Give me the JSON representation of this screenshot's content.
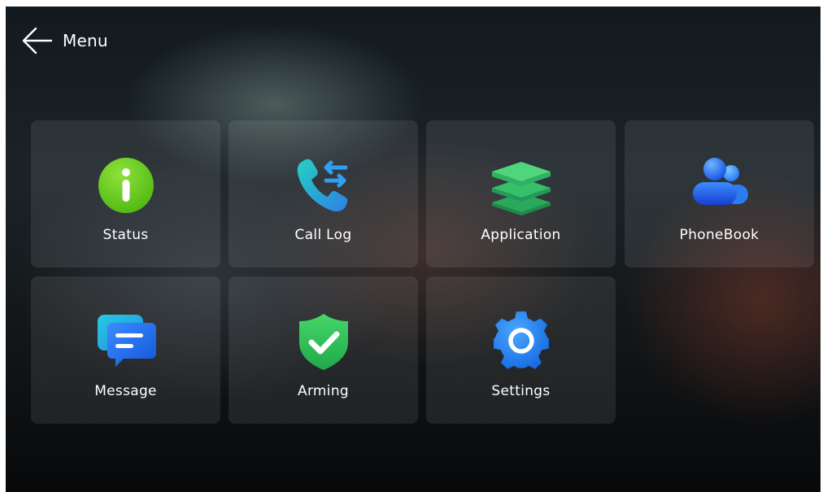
{
  "header": {
    "back_icon": "arrow-left-icon",
    "title": "Menu"
  },
  "tiles": [
    {
      "label": "Status",
      "icon": "info-icon",
      "color": "#6fcf1e"
    },
    {
      "label": "Call Log",
      "icon": "call-log-icon",
      "color": "#2ea8e8"
    },
    {
      "label": "Application",
      "icon": "layers-icon",
      "color": "#2fc36a"
    },
    {
      "label": "PhoneBook",
      "icon": "contacts-icon",
      "color": "#1f6ff0"
    },
    {
      "label": "Message",
      "icon": "chat-icon",
      "color": "#1f7de8"
    },
    {
      "label": "Arming",
      "icon": "shield-check-icon",
      "color": "#2fbf55"
    },
    {
      "label": "Settings",
      "icon": "gear-icon",
      "color": "#1f88f2"
    }
  ]
}
